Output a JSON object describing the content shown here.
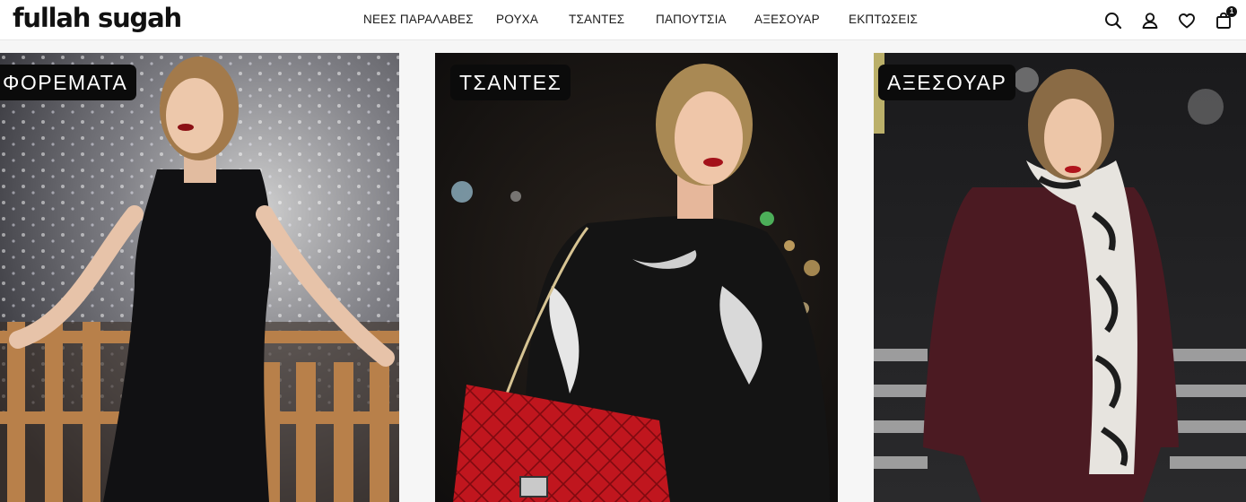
{
  "brand": {
    "logo": "fullah sugah"
  },
  "nav": {
    "items": [
      {
        "label": "ΝΕΕΣ ΠΑΡΑΛΑΒΕΣ"
      },
      {
        "label": "ΡΟΥΧΑ"
      },
      {
        "label": "ΤΣΑΝΤΕΣ"
      },
      {
        "label": "ΠΑΠΟΥΤΣΙΑ"
      },
      {
        "label": "ΑΞΕΣΟΥΑΡ"
      },
      {
        "label": "ΕΚΠΤΩΣΕΙΣ"
      }
    ]
  },
  "header_icons": {
    "search": "search-icon",
    "account": "user-icon",
    "wishlist": "heart-icon",
    "cart": "shopping-bag-icon",
    "cart_count": "1"
  },
  "categories": [
    {
      "label": "ΦΟΡΕΜΑΤΑ"
    },
    {
      "label": "ΤΣΑΝΤΕΣ"
    },
    {
      "label": "ΑΞΕΣΟΥΑΡ"
    }
  ],
  "colors": {
    "header_bg": "#ffffff",
    "page_bg": "#f6f6f6",
    "tag_bg": "#0b0b0b",
    "tag_text": "#ffffff",
    "text": "#1a1a1a"
  }
}
